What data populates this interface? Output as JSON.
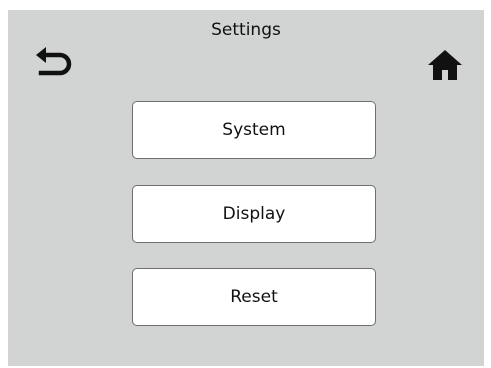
{
  "header": {
    "title": "Settings",
    "back_icon": "back-arrow-icon",
    "home_icon": "home-icon"
  },
  "menu": {
    "items": [
      {
        "label": "System"
      },
      {
        "label": "Display"
      },
      {
        "label": "Reset"
      }
    ]
  },
  "colors": {
    "screen_background": "#d2d4d3",
    "button_background": "#ffffff",
    "button_border": "#6f6f6f",
    "text": "#111111"
  }
}
